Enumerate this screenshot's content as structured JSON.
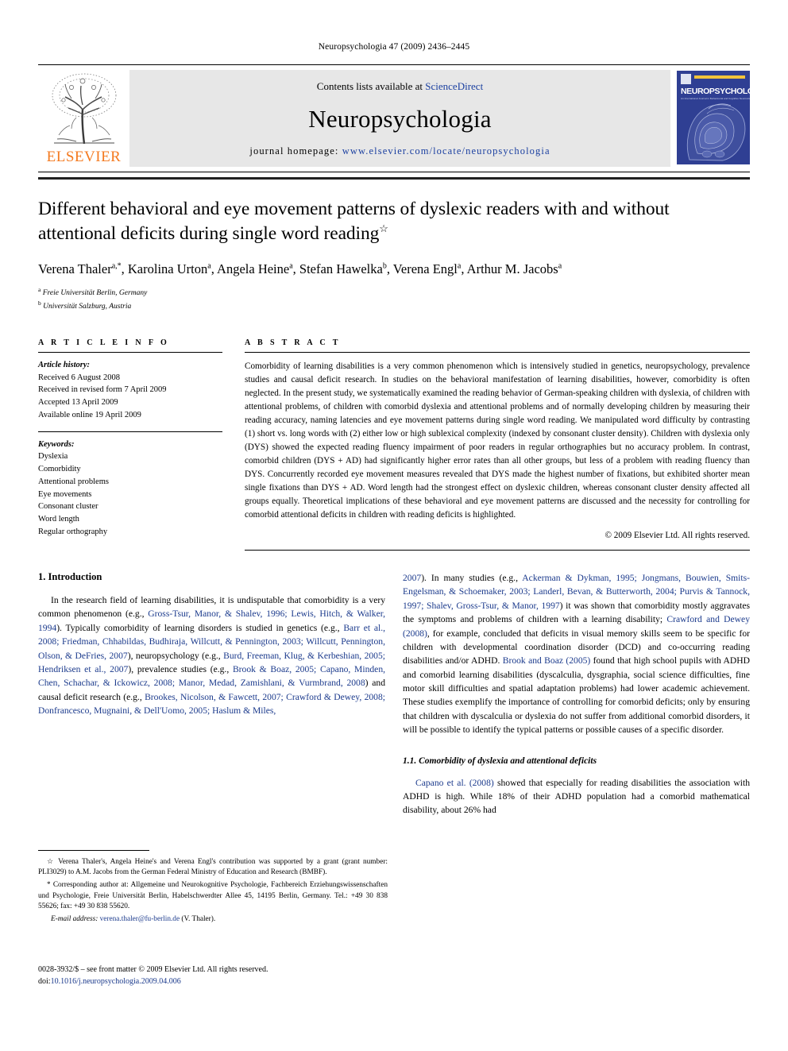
{
  "running_head": "Neuropsychologia 47 (2009) 2436–2445",
  "masthead": {
    "publisher_name": "ELSEVIER",
    "contents_prefix": "Contents lists available at ",
    "contents_link": "ScienceDirect",
    "journal_name": "Neuropsychologia",
    "homepage_label": "journal homepage:",
    "homepage_url": "www.elsevier.com/locate/neuropsychologia",
    "cover_title": "NEUROPSYCHOLOGIA",
    "cover_subtitle": "An International Journal in Behavioural and Cognitive Neuroscience",
    "cover_color": "#2f3f93",
    "accent_color": "#f47a20",
    "link_color": "#1a3fa0"
  },
  "article": {
    "title": "Different behavioral and eye movement patterns of dyslexic readers with and without attentional deficits during single word reading",
    "title_footnote_marker": "☆",
    "authors_html": "Verena Thaler<sup>a,*</sup>, Karolina Urton<sup>a</sup>, Angela Heine<sup>a</sup>, Stefan Hawelka<sup>b</sup>, Verena Engl<sup>a</sup>, Arthur M. Jacobs<sup>a</sup>",
    "affiliations": [
      {
        "marker": "a",
        "text": "Freie Universität Berlin, Germany"
      },
      {
        "marker": "b",
        "text": "Universität Salzburg, Austria"
      }
    ]
  },
  "article_info": {
    "heading": "A R T I C L E   I N F O",
    "history_label": "Article history:",
    "history": [
      "Received 6 August 2008",
      "Received in revised form 7 April 2009",
      "Accepted 13 April 2009",
      "Available online 19 April 2009"
    ],
    "keywords_label": "Keywords:",
    "keywords": [
      "Dyslexia",
      "Comorbidity",
      "Attentional problems",
      "Eye movements",
      "Consonant cluster",
      "Word length",
      "Regular orthography"
    ]
  },
  "abstract": {
    "heading": "A B S T R A C T",
    "text": "Comorbidity of learning disabilities is a very common phenomenon which is intensively studied in genetics, neuropsychology, prevalence studies and causal deficit research. In studies on the behavioral manifestation of learning disabilities, however, comorbidity is often neglected. In the present study, we systematically examined the reading behavior of German-speaking children with dyslexia, of children with attentional problems, of children with comorbid dyslexia and attentional problems and of normally developing children by measuring their reading accuracy, naming latencies and eye movement patterns during single word reading. We manipulated word difficulty by contrasting (1) short vs. long words with (2) either low or high sublexical complexity (indexed by consonant cluster density). Children with dyslexia only (DYS) showed the expected reading fluency impairment of poor readers in regular orthographies but no accuracy problem. In contrast, comorbid children (DYS + AD) had significantly higher error rates than all other groups, but less of a problem with reading fluency than DYS. Concurrently recorded eye movement measures revealed that DYS made the highest number of fixations, but exhibited shorter mean single fixations than DYS + AD. Word length had the strongest effect on dyslexic children, whereas consonant cluster density affected all groups equally. Theoretical implications of these behavioral and eye movement patterns are discussed and the necessity for controlling for comorbid attentional deficits in children with reading deficits is highlighted.",
    "copyright": "© 2009 Elsevier Ltd. All rights reserved."
  },
  "body": {
    "section_number_title": "1.  Introduction",
    "left_paragraph_1_parts": [
      {
        "t": "In the research field of learning disabilities, it is undisputable that comorbidity is a very common phenomenon (e.g., ",
        "r": false
      },
      {
        "t": "Gross-Tsur, Manor, & Shalev, 1996; Lewis, Hitch, & Walker, 1994",
        "r": true
      },
      {
        "t": "). Typically comorbidity of learning disorders is studied in genetics (e.g., ",
        "r": false
      },
      {
        "t": "Barr et al., 2008; Friedman, Chhabildas, Budhiraja, Willcutt, & Pennington, 2003; Willcutt, Pennington, Olson, & DeFries, 2007",
        "r": true
      },
      {
        "t": "), neuropsychology (e.g., ",
        "r": false
      },
      {
        "t": "Burd, Freeman, Klug, & Kerbeshian, 2005; Hendriksen et al., 2007",
        "r": true
      },
      {
        "t": "), prevalence studies (e.g., ",
        "r": false
      },
      {
        "t": "Brook & Boaz, 2005; Capano, Minden, Chen, Schachar, & Ickowicz, 2008; Manor, Medad, Zamishlani, & Vurmbrand, 2008",
        "r": true
      },
      {
        "t": ") and causal deficit research (e.g., ",
        "r": false
      },
      {
        "t": "Brookes, Nicolson, & Fawcett, 2007; Crawford & Dewey, 2008; Donfrancesco, Mugnaini, & Dell'Uomo, 2005; Haslum & Miles, 2007",
        "r": true
      },
      {
        "t": "). In many studies (e.g., ",
        "r": false
      },
      {
        "t": "Ackerman & Dykman, 1995; Jongmans, Bouwien, Smits-Engelsman, & Schoemaker, 2003; Landerl, Bevan, & Butterworth, 2004; Purvis & Tannock, 1997; Shalev, Gross-Tsur, & Manor, 1997",
        "r": true
      },
      {
        "t": ") it was shown that comorbidity mostly aggravates the symptoms and problems of children with a learning disability; ",
        "r": false
      },
      {
        "t": "Crawford and Dewey (2008)",
        "r": true
      },
      {
        "t": ", for example, concluded that deficits in visual memory skills seem to be specific for children with developmental coordination disorder (DCD) and co-occurring reading disabilities and/or ADHD. ",
        "r": false
      },
      {
        "t": "Brook and Boaz (2005)",
        "r": true
      },
      {
        "t": " found that high school pupils with ADHD and comorbid learning disabilities (dyscalculia, dysgraphia, social science difficulties, fine motor skill difficulties and spatial adaptation problems) had lower academic achievement. These studies exemplify the importance of controlling for comorbid deficits; only by ensuring that children with dyscalculia or dyslexia do not suffer from additional comorbid disorders, it will be possible to identify the typical patterns or possible causes of a specific disorder.",
        "r": false
      }
    ],
    "subsection_title": "1.1.  Comorbidity of dyslexia and attentional deficits",
    "right_paragraph_parts": [
      {
        "t": "Capano et al. (2008)",
        "r": true
      },
      {
        "t": " showed that especially for reading disabilities the association with ADHD is high. While 18% of their ADHD population had a comorbid mathematical disability, about 26% had",
        "r": false
      }
    ]
  },
  "footnotes": [
    {
      "marker": "☆",
      "text": "Verena Thaler's, Angela Heine's and Verena Engl's contribution was supported by a grant (grant number: PLI3029) to A.M. Jacobs from the German Federal Ministry of Education and Research (BMBF)."
    },
    {
      "marker": "*",
      "text": "Corresponding author at: Allgemeine und Neurokognitive Psychologie, Fachbereich Erziehungswissenschaften und Psychologie, Freie Universität Berlin, Habelschwerdter Allee 45, 14195 Berlin, Germany. Tel.: +49 30 838 55626; fax: +49 30 838 55620."
    }
  ],
  "email_note": {
    "label": "E-mail address:",
    "address": "verena.thaler@fu-berlin.de",
    "suffix": "(V. Thaler)."
  },
  "imprint": {
    "line1": "0028-3932/$ – see front matter © 2009 Elsevier Ltd. All rights reserved.",
    "doi_label": "doi:",
    "doi_value": "10.1016/j.neuropsychologia.2009.04.006"
  }
}
